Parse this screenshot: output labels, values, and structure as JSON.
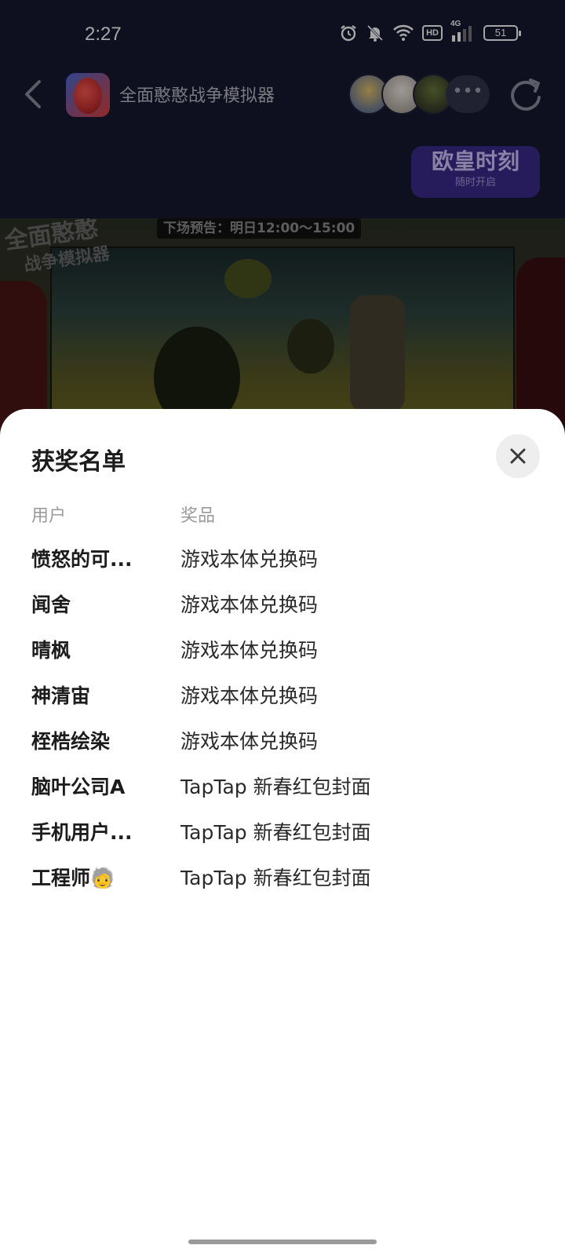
{
  "status_bar": {
    "time": "2:27",
    "network": "4G",
    "hd_label": "HD",
    "battery": "51"
  },
  "app_bar": {
    "title": "全面憨憨战争模拟器",
    "more": "•••"
  },
  "promo": {
    "title": "欧皇时刻",
    "subtitle": "随时开启"
  },
  "game_preview": {
    "schedule": "下场预告：明日12:00～15:00",
    "logo_line1": "全面憨憨",
    "logo_line2": "战争模拟器"
  },
  "sheet": {
    "title": "获奖名单",
    "column_user": "用户",
    "column_prize": "奖品",
    "winners": [
      {
        "user": "愤怒的可...",
        "prize": "游戏本体兑换码"
      },
      {
        "user": "闻舍",
        "prize": "游戏本体兑换码"
      },
      {
        "user": "晴枫",
        "prize": "游戏本体兑换码"
      },
      {
        "user": "神清宙",
        "prize": "游戏本体兑换码"
      },
      {
        "user": "桎梏绘染",
        "prize": "游戏本体兑换码"
      },
      {
        "user": "脑叶公司A",
        "prize": "TapTap 新春红包封面"
      },
      {
        "user": "手机用户...",
        "prize": "TapTap 新春红包封面"
      },
      {
        "user": "工程师🧓",
        "prize": "TapTap 新春红包封面"
      }
    ]
  },
  "colors": {
    "sheet_bg": "#ffffff",
    "header_bg": "#161830",
    "promo_bg": "#3b2a8c",
    "close_bg": "#eeeeef"
  }
}
